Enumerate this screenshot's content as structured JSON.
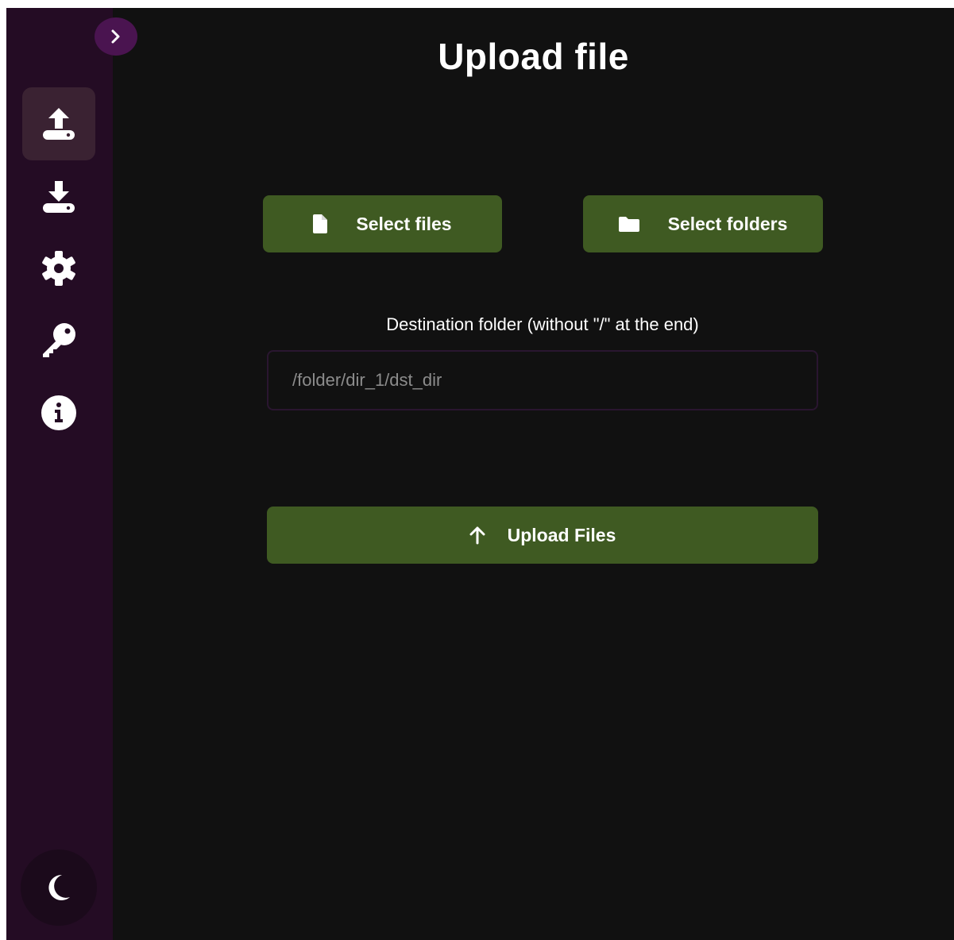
{
  "page": {
    "title": "Upload file"
  },
  "sidebar": {
    "toggle_icon": "chevron-right-icon",
    "items": [
      {
        "name": "upload",
        "icon": "upload-icon",
        "active": true
      },
      {
        "name": "download",
        "icon": "download-icon",
        "active": false
      },
      {
        "name": "settings",
        "icon": "gear-icon",
        "active": false
      },
      {
        "name": "keys",
        "icon": "key-icon",
        "active": false
      },
      {
        "name": "info",
        "icon": "info-icon",
        "active": false
      }
    ],
    "theme_icon": "moon-icon"
  },
  "actions": {
    "select_files_label": "Select files",
    "select_folders_label": "Select folders",
    "upload_label": "Upload Files"
  },
  "destination": {
    "label": "Destination folder (without \"/\" at the end)",
    "placeholder": "/folder/dir_1/dst_dir",
    "value": ""
  },
  "colors": {
    "background": "#111111",
    "sidebar": "#240c24",
    "sidebar_active": "#3a2232",
    "toggle": "#4a1450",
    "button": "#3f5a22",
    "input_border": "#2a1630"
  }
}
